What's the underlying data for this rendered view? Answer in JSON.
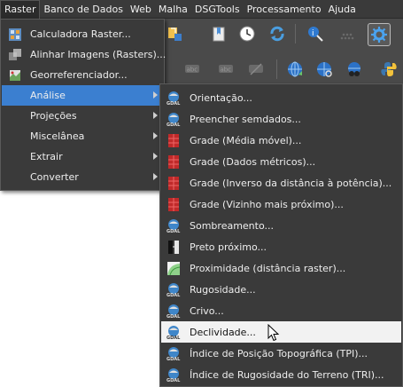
{
  "menubar": {
    "items": [
      {
        "label": "Raster",
        "active": true
      },
      {
        "label": "Banco de Dados"
      },
      {
        "label": "Web"
      },
      {
        "label": "Malha"
      },
      {
        "label": "DSGTools"
      },
      {
        "label": "Processamento"
      },
      {
        "label": "Ajuda"
      }
    ]
  },
  "toolbar": {
    "icons": [
      "raster-plugin-icon",
      "bookmark-icon",
      "clock-icon",
      "refresh-icon",
      "identify-icon",
      "dots-icon",
      "settings-icon",
      "label-icon",
      "label-icon-2",
      "label-icon-3",
      "globe-icon",
      "globe-search-icon",
      "globe-binoculars-icon",
      "python-icon"
    ]
  },
  "raster_menu": {
    "items": [
      {
        "label": "Calculadora Raster...",
        "icon": "raster-calculator-icon"
      },
      {
        "label": "Alinhar Imagens (Rasters)...",
        "icon": "align-rasters-icon"
      },
      {
        "label": "Georreferenciador...",
        "icon": "georeferencer-icon"
      },
      {
        "label": "Análise",
        "submenu": true,
        "highlighted": true
      },
      {
        "label": "Projeções",
        "submenu": true
      },
      {
        "label": "Miscelânea",
        "submenu": true
      },
      {
        "label": "Extrair",
        "submenu": true
      },
      {
        "label": "Converter",
        "submenu": true
      }
    ]
  },
  "analise_submenu": {
    "items": [
      {
        "label": "Orientação...",
        "icon": "gdal-icon"
      },
      {
        "label": "Preencher semdados...",
        "icon": "gdal-icon"
      },
      {
        "label": "Grade (Média móvel)...",
        "icon": "grid-red-icon"
      },
      {
        "label": "Grade (Dados métricos)...",
        "icon": "grid-red-icon"
      },
      {
        "label": "Grade (Inverso da distância à potência)...",
        "icon": "grid-red-icon"
      },
      {
        "label": "Grade (Vizinho mais próximo)...",
        "icon": "grid-red-icon"
      },
      {
        "label": "Sombreamento...",
        "icon": "gdal-icon"
      },
      {
        "label": "Preto próximo...",
        "icon": "nearblack-icon"
      },
      {
        "label": "Proximidade (distância raster)...",
        "icon": "proximity-icon"
      },
      {
        "label": "Rugosidade...",
        "icon": "gdal-icon"
      },
      {
        "label": "Crivo...",
        "icon": "gdal-icon"
      },
      {
        "label": "Declividade...",
        "icon": "gdal-icon",
        "hovered": true
      },
      {
        "label": "Índice de Posição Topográfica (TPI)...",
        "icon": "gdal-icon"
      },
      {
        "label": "Índice de Rugosidade do Terreno (TRI)...",
        "icon": "gdal-icon"
      }
    ]
  },
  "colors": {
    "menu_bg": "#3a3a3a",
    "highlight": "#3b7fd0",
    "hover_item": "#f2f2f2"
  }
}
